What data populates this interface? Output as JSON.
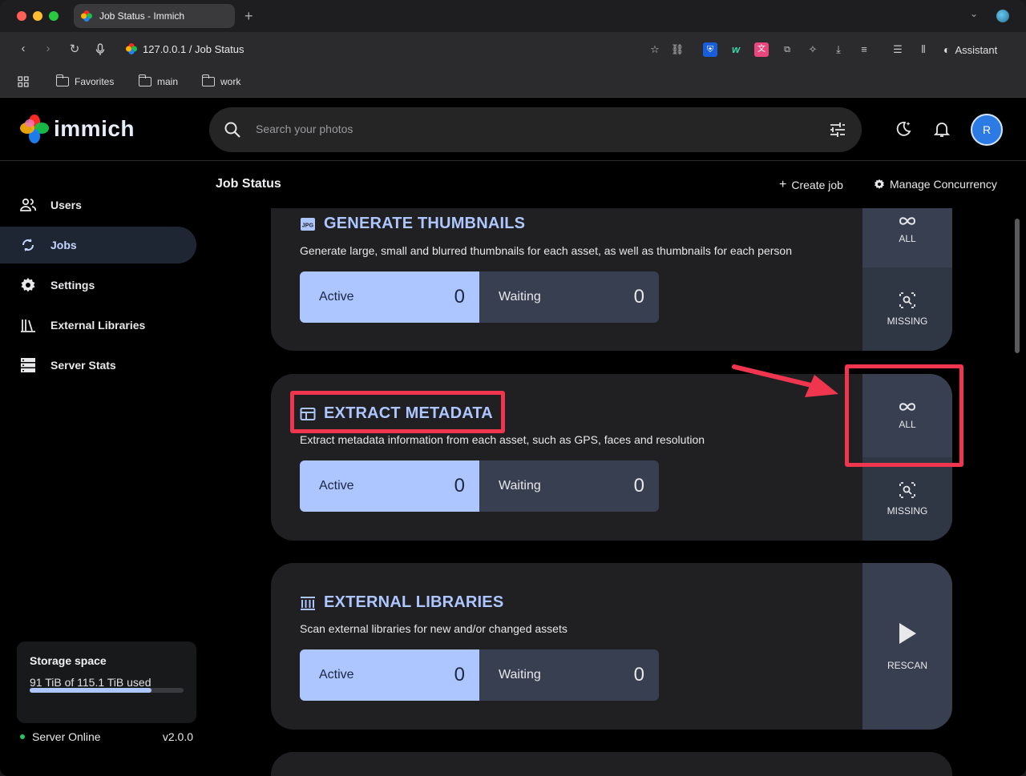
{
  "browser": {
    "tab_title": "Job Status - Immich",
    "url": "127.0.0.1 / Job Status",
    "assistant_label": "Assistant",
    "bookmarks": [
      "Favorites",
      "main",
      "work"
    ]
  },
  "app": {
    "logo_text": "immich",
    "search_placeholder": "Search your photos",
    "avatar_initial": "R"
  },
  "sidebar": {
    "items": [
      {
        "label": "Users",
        "icon": "users-icon"
      },
      {
        "label": "Jobs",
        "icon": "sync-icon"
      },
      {
        "label": "Settings",
        "icon": "gear-icon"
      },
      {
        "label": "External Libraries",
        "icon": "library-icon"
      },
      {
        "label": "Server Stats",
        "icon": "server-icon"
      }
    ],
    "active": "Jobs",
    "storage": {
      "title": "Storage space",
      "used_text": "91 TiB of 115.1 TiB used",
      "used_fraction": 0.79
    },
    "status": {
      "label": "Server Online",
      "version": "v2.0.0"
    }
  },
  "main": {
    "title": "Job Status",
    "create_job": "Create job",
    "manage_concurrency": "Manage Concurrency",
    "jobs": [
      {
        "title": "GENERATE THUMBNAILS",
        "description": "Generate large, small and blurred thumbnails for each asset, as well as thumbnails for each person",
        "active_label": "Active",
        "active": "0",
        "waiting_label": "Waiting",
        "waiting": "0",
        "action_all": "ALL",
        "action_missing": "MISSING"
      },
      {
        "title": "EXTRACT METADATA",
        "description": "Extract metadata information from each asset, such as GPS, faces and resolution",
        "active_label": "Active",
        "active": "0",
        "waiting_label": "Waiting",
        "waiting": "0",
        "action_all": "ALL",
        "action_missing": "MISSING"
      },
      {
        "title": "EXTERNAL LIBRARIES",
        "description": "Scan external libraries for new and/or changed assets",
        "active_label": "Active",
        "active": "0",
        "waiting_label": "Waiting",
        "waiting": "0",
        "action_rescan": "RESCAN"
      }
    ]
  },
  "colors": {
    "accent": "#adc6ff",
    "highlight": "#f0364f",
    "online": "#22c55e"
  }
}
